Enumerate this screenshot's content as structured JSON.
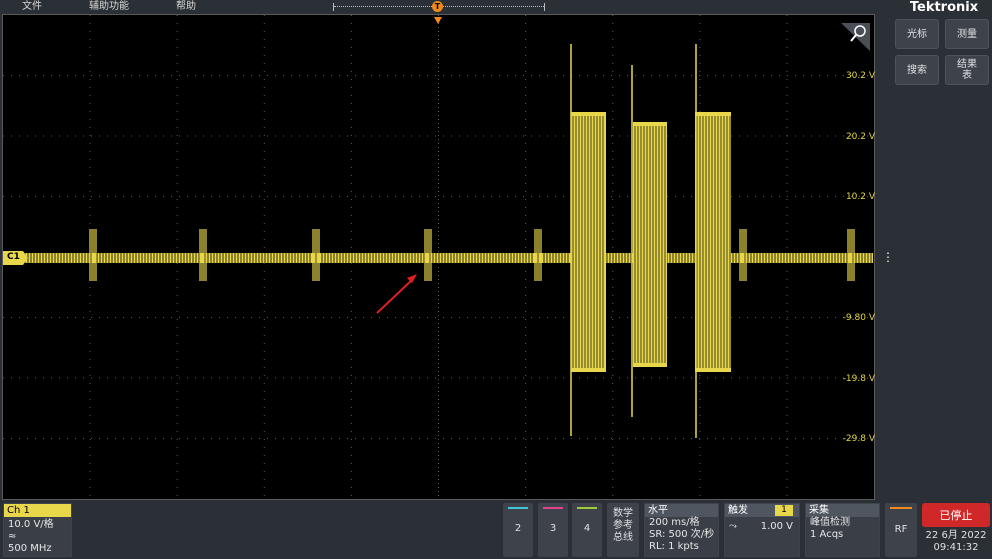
{
  "brand": "Tektronix",
  "menu": {
    "file": "文件",
    "utility": "辅助功能",
    "help": "帮助"
  },
  "trigger_marker": "T",
  "side_buttons": {
    "cursor": "光标",
    "measure": "测量",
    "search": "搜索",
    "results_l1": "结果",
    "results_l2": "表"
  },
  "channel_label": "C1",
  "voltage_labels": [
    "30.2 V",
    "20.2 V",
    "10.2 V",
    "-9.80 V",
    "-19.8 V",
    "-29.8 V"
  ],
  "ch1": {
    "title": "Ch 1",
    "scale": "10.0 V/格",
    "coupling_icon": "≈",
    "bandwidth": "500 MHz"
  },
  "channels": [
    {
      "label": "2",
      "color": "#3fc6d8"
    },
    {
      "label": "3",
      "color": "#e0408c"
    },
    {
      "label": "4",
      "color": "#9ccc3c"
    }
  ],
  "math_ref_bus": {
    "l1": "数学",
    "l2": "参考",
    "l3": "总线"
  },
  "horizontal": {
    "title": "水平",
    "scale": "200 ms/格",
    "sample_rate": "SR: 500 次/秒",
    "record_length": "RL: 1 kpts"
  },
  "trigger": {
    "title": "触发",
    "source": "1",
    "slope_icon": "⤳",
    "level": "1.00 V"
  },
  "acquisition": {
    "title": "采集",
    "mode": "峰值检测",
    "count": "1 Acqs"
  },
  "rf": "RF",
  "status": "已停止",
  "date": "22 6月 2022",
  "time": "09:41:32",
  "colors": {
    "trace": "#e8d74a",
    "accent": "#f08a1c",
    "stop": "#d02828",
    "grid": "#5a5a5a"
  }
}
